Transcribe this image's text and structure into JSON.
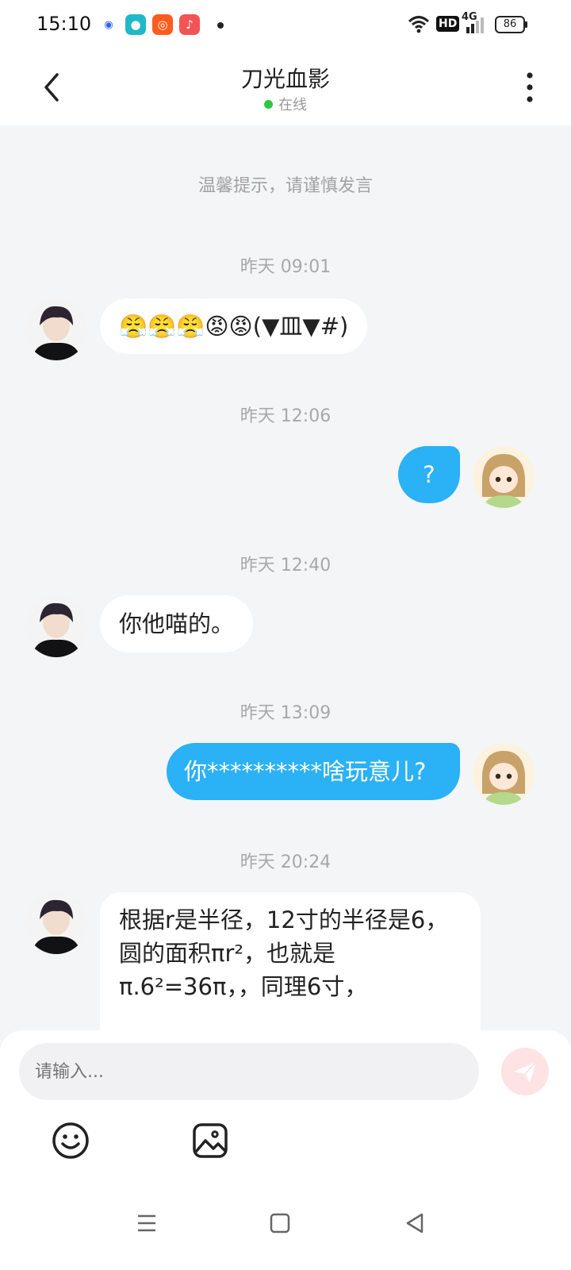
{
  "status": {
    "time": "15:10",
    "hd": "HD",
    "network": "4G",
    "battery": "86"
  },
  "header": {
    "title": "刀光血影",
    "presence": "在线"
  },
  "chat": {
    "tip": "温馨提示，请谨慎发言",
    "messages": [
      {
        "time": "昨天 09:01",
        "side": "in",
        "text": "😤😤😤😡😡(▼皿▼#)"
      },
      {
        "time": "昨天 12:06",
        "side": "out",
        "text": "?"
      },
      {
        "time": "昨天 12:40",
        "side": "in",
        "text": "你他喵的。"
      },
      {
        "time": "昨天 13:09",
        "side": "out",
        "text": "你**********啥玩意儿?"
      },
      {
        "time": "昨天 20:24",
        "side": "in",
        "text": "根据r是半径，12寸的半径是6，圆的面积πr²，也就是π.6²=36π，，同理6寸，"
      }
    ]
  },
  "composer": {
    "placeholder": "请输入..."
  },
  "icons": {
    "back": "chevron-left-icon",
    "more": "more-vertical-icon",
    "emoji": "smile-icon",
    "image": "image-icon",
    "send": "paper-plane-icon"
  },
  "colors": {
    "outgoing_bubble": "#2bb1f5",
    "online": "#2ec742",
    "send_button": "#fde3e3"
  }
}
